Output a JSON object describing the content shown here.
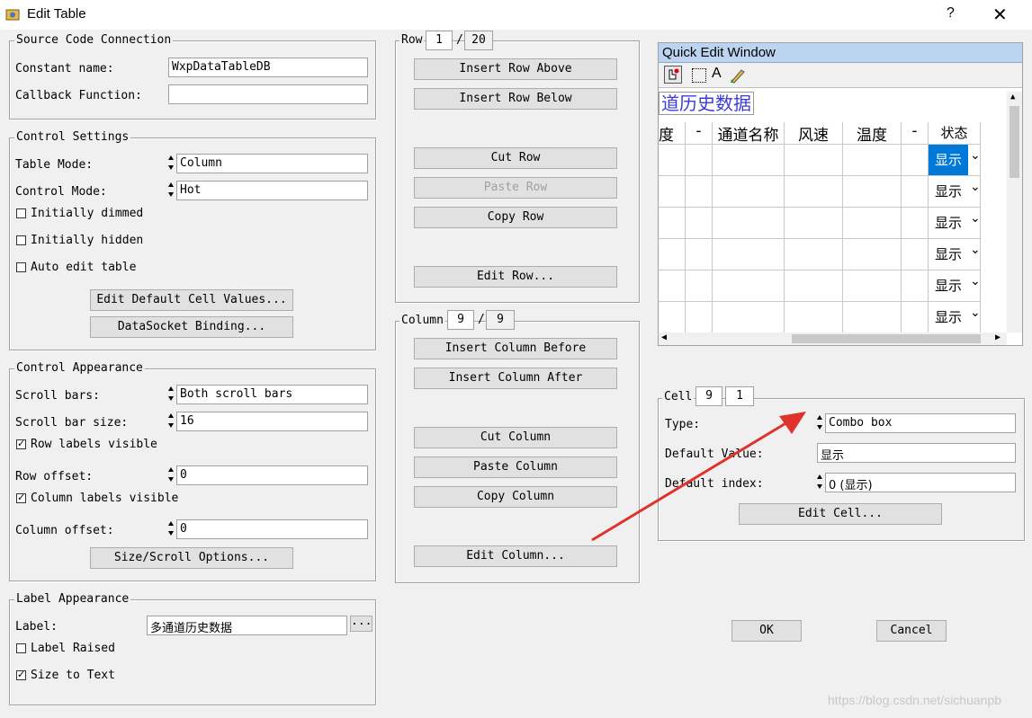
{
  "window": {
    "title": "Edit Table",
    "help": "?",
    "close": "✕"
  },
  "source": {
    "legend": "Source Code Connection",
    "constant_label": "Constant name:",
    "constant_value": "WxpDataTableDB",
    "callback_label": "Callback Function:",
    "callback_value": ""
  },
  "control_settings": {
    "legend": "Control Settings",
    "table_mode_label": "Table Mode:",
    "table_mode_value": "Column",
    "control_mode_label": "Control Mode:",
    "control_mode_value": "Hot",
    "initially_dimmed": "Initially dimmed",
    "initially_hidden": "Initially hidden",
    "auto_edit": "Auto edit table",
    "edit_default_btn": "Edit Default Cell Values...",
    "datasocket_btn": "DataSocket Binding..."
  },
  "control_appearance": {
    "legend": "Control Appearance",
    "scroll_bars_label": "Scroll bars:",
    "scroll_bars_value": "Both scroll bars",
    "scroll_bar_size_label": "Scroll bar size:",
    "scroll_bar_size_value": "16",
    "row_labels_visible": "Row labels visible",
    "row_offset_label": "Row offset:",
    "row_offset_value": "0",
    "column_labels_visible": "Column labels visible",
    "column_offset_label": "Column offset:",
    "column_offset_value": "0",
    "size_scroll_btn": "Size/Scroll Options..."
  },
  "label_appearance": {
    "legend": "Label Appearance",
    "label_label": "Label:",
    "label_value": "多通道历史数据",
    "ellipsis_btn": "...",
    "label_raised": "Label Raised",
    "size_to_text": "Size to Text"
  },
  "row": {
    "legend": "Row",
    "current": "1",
    "slash": "/",
    "total": "20",
    "insert_above": "Insert Row Above",
    "insert_below": "Insert Row Below",
    "cut": "Cut Row",
    "paste": "Paste Row",
    "copy": "Copy Row",
    "edit": "Edit Row..."
  },
  "column": {
    "legend": "Column",
    "current": "9",
    "slash": "/",
    "total": "9",
    "insert_before": "Insert Column Before",
    "insert_after": "Insert Column After",
    "cut": "Cut Column",
    "paste": "Paste Column",
    "copy": "Copy Column",
    "edit": "Edit Column..."
  },
  "quick_edit": {
    "title": "Quick Edit Window",
    "tool_a": "A",
    "table_label": "道历史数据",
    "headers": [
      "度",
      "-",
      "通道名称",
      "风速",
      "温度",
      "-",
      "状态"
    ],
    "cell_value": "显示",
    "rows": 6
  },
  "cell": {
    "legend": "Cell",
    "col": "9",
    "row": "1",
    "type_label": "Type:",
    "type_value": "Combo box",
    "default_value_label": "Default Value:",
    "default_value": "显示",
    "default_index_label": "Default index:",
    "default_index_value": "0 (显示)",
    "edit_cell_btn": "Edit Cell..."
  },
  "dialog": {
    "ok": "OK",
    "cancel": "Cancel"
  },
  "watermark": "https://blog.csdn.net/sichuanpb",
  "colors": {
    "selected": "#0078d7",
    "title_bar": "#bcd4ef",
    "arrow": "#e0322d",
    "label_text": "#3b3bdb"
  }
}
